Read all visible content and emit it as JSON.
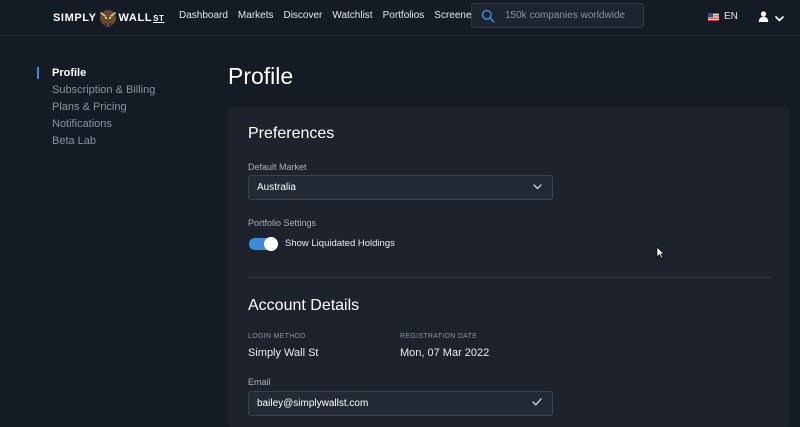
{
  "header": {
    "logo": {
      "left": "SIMPLY",
      "right": "WALL",
      "suffix": "ST"
    },
    "nav": [
      "Dashboard",
      "Markets",
      "Discover",
      "Watchlist",
      "Portfolios",
      "Screener"
    ],
    "search": {
      "placeholder": "150k companies worldwide",
      "icon": "search-icon"
    },
    "language": {
      "label": "EN",
      "icon": "us-flag-icon"
    },
    "user": {
      "icon": "user-icon",
      "chevron": "chevron-down-icon"
    }
  },
  "sidebar": {
    "items": [
      {
        "label": "Profile",
        "active": true
      },
      {
        "label": "Subscription & Billing",
        "active": false
      },
      {
        "label": "Plans & Pricing",
        "active": false
      },
      {
        "label": "Notifications",
        "active": false
      },
      {
        "label": "Beta Lab",
        "active": false
      }
    ]
  },
  "page": {
    "title": "Profile"
  },
  "preferences": {
    "title": "Preferences",
    "default_market_label": "Default Market",
    "default_market_value": "Australia",
    "portfolio_settings_label": "Portfolio Settings",
    "toggle_label": "Show Liquidated Holdings",
    "toggle_on": true
  },
  "account": {
    "title": "Account Details",
    "login_method_label": "LOGIN METHOD",
    "login_method_value": "Simply Wall St",
    "registration_date_label": "REGISTRATION DATE",
    "registration_date_value": "Mon, 07 Mar 2022",
    "email_label": "Email",
    "email_value": "bailey@simplywallst.com"
  },
  "colors": {
    "background": "#151b24",
    "card": "#1d222c",
    "accent": "#3b8bd8"
  }
}
